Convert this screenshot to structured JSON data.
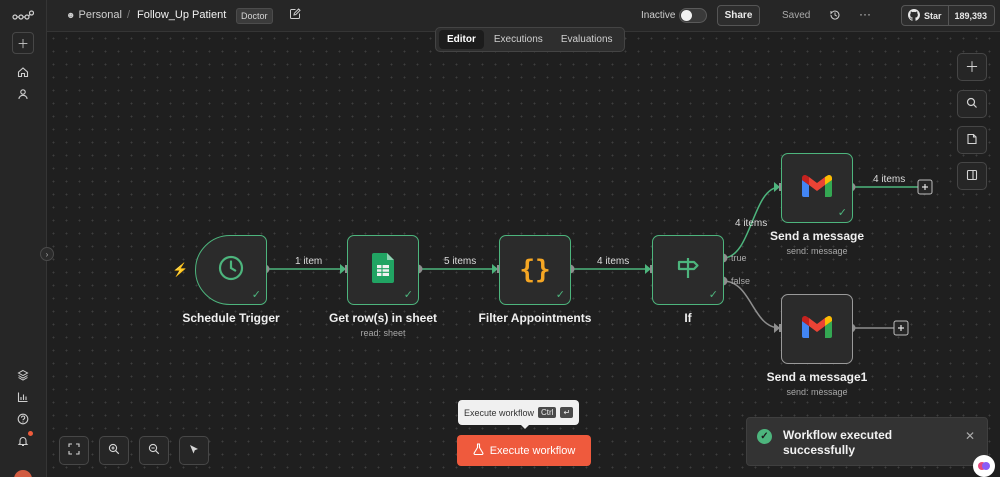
{
  "header": {
    "project": "Personal",
    "workflow_name": "Follow_Up Patient",
    "tag": "Doctor",
    "status_label": "Inactive",
    "share_label": "Share",
    "saved_label": "Saved",
    "star_label": "Star",
    "star_count": "189,393"
  },
  "view_tabs": [
    {
      "label": "Editor",
      "active": true
    },
    {
      "label": "Executions",
      "active": false
    },
    {
      "label": "Evaluations",
      "active": false
    }
  ],
  "nodes": {
    "schedule": {
      "name": "Schedule Trigger",
      "subtitle": "",
      "icon": "clock-icon"
    },
    "sheets": {
      "name": "Get row(s) in sheet",
      "subtitle": "read: sheet",
      "icon": "google-sheets-icon"
    },
    "filter": {
      "name": "Filter Appointments",
      "subtitle": "",
      "icon": "code-braces-icon"
    },
    "if": {
      "name": "If",
      "subtitle": "",
      "icon": "signpost-icon"
    },
    "gmail1": {
      "name": "Send a message",
      "subtitle": "send: message",
      "icon": "gmail-icon"
    },
    "gmail2": {
      "name": "Send a message1",
      "subtitle": "send: message",
      "icon": "gmail-icon"
    }
  },
  "edges": {
    "schedule_to_sheets": "1 item",
    "sheets_to_filter": "5 items",
    "filter_to_if": "4 items",
    "if_true_to_gmail1": "4 items",
    "gmail1_out": "4 items",
    "true_label": "true",
    "false_label": "false"
  },
  "execute": {
    "tooltip_text": "Execute workflow",
    "shortcut_key1": "Ctrl",
    "shortcut_key2": "↵",
    "button_label": "Execute workflow"
  },
  "toast": {
    "message": "Workflow executed successfully"
  },
  "colors": {
    "success": "#4db57d",
    "accent": "#ef5a3d",
    "canvas_bg": "#1f1f1f"
  }
}
